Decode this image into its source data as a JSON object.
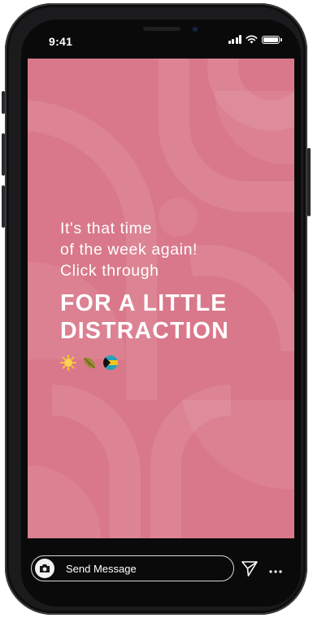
{
  "status_bar": {
    "time": "9:41"
  },
  "story": {
    "background_color": "#d9788a",
    "lines_light": [
      "It's that time",
      "of the week again!",
      "Click through"
    ],
    "lines_bold": [
      "FOR A LITTLE",
      "DISTRACTION"
    ],
    "emojis": [
      "sun",
      "leaf",
      "bahamas-flag"
    ]
  },
  "reply_bar": {
    "placeholder": "Send Message",
    "icons": [
      "camera-icon",
      "send-icon",
      "more-icon"
    ]
  }
}
